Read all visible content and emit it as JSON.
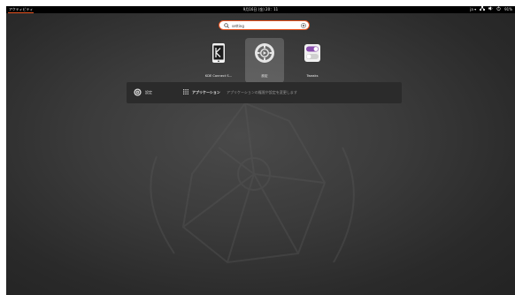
{
  "topbar": {
    "activities_label": "アクティビティ",
    "clock": "9月16日 (金) 20：11",
    "input_method": "ja ▾",
    "battery": "91%",
    "icons": [
      "network-icon",
      "volume-icon",
      "power-icon"
    ]
  },
  "search": {
    "value": "setting",
    "placeholder": ""
  },
  "apps": [
    {
      "label": "KDE Connect S...",
      "icon": "kde-connect-icon"
    },
    {
      "label": "設定",
      "icon": "settings-icon",
      "selected": true
    },
    {
      "label": "Tweaks",
      "icon": "tweaks-icon"
    }
  ],
  "provider": {
    "name": "設定",
    "result_title": "アプリケーション",
    "result_desc": "アプリケーションの権限や設定を変更します"
  },
  "colors": {
    "accent": "#e95420",
    "topbar": "#000000",
    "panel": "#2b2b2b",
    "tweaks_purple": "#8a4fae"
  }
}
